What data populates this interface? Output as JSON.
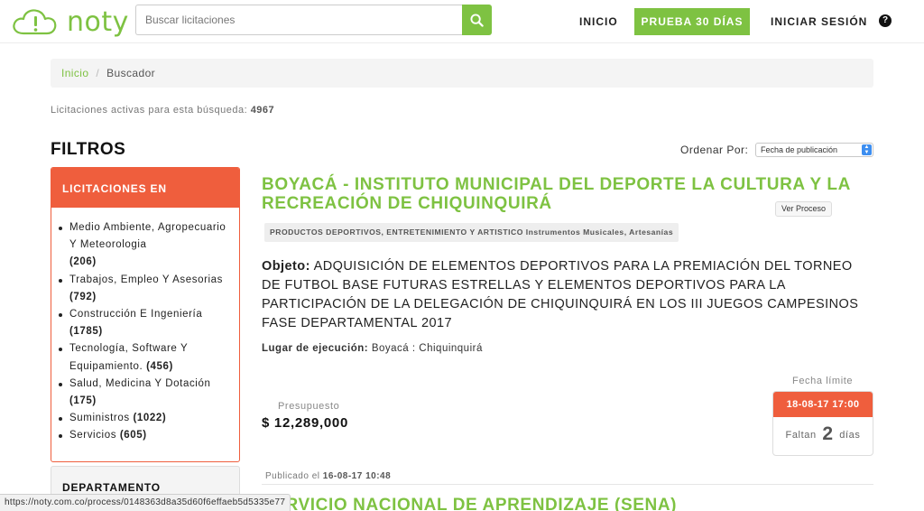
{
  "header": {
    "logo_text": "noty",
    "search_placeholder": "Buscar licitaciones",
    "nav": {
      "inicio": "INICIO",
      "trial": "PRUEBA 30 DÍAS",
      "login": "INICIAR SESIÓN",
      "help": "?"
    },
    "brand_color": "#7ec242"
  },
  "breadcrumb": {
    "home": "Inicio",
    "separator": "/",
    "current": "Buscador"
  },
  "summary": {
    "label": "Licitaciones activas para esta búsqueda:",
    "count": "4967"
  },
  "filters": {
    "title": "FILTROS",
    "panel_title": "LICITACIONES EN",
    "accent_color": "#ef5e3d",
    "items": [
      {
        "label": "Medio Ambiente, Agropecuario Y Meteorologia",
        "count": "(206)"
      },
      {
        "label": "Trabajos, Empleo Y Asesorias",
        "count": "(792)"
      },
      {
        "label": "Construcción E Ingeniería",
        "count": "(1785)"
      },
      {
        "label": "Tecnología, Software Y Equipamiento.",
        "count": "(456)"
      },
      {
        "label": "Salud, Medicina Y Dotación",
        "count": "(175)"
      },
      {
        "label": "Suministros",
        "count": "(1022)"
      },
      {
        "label": "Servicios",
        "count": "(605)"
      }
    ],
    "next_panel_title": "DEPARTAMENTO"
  },
  "order": {
    "label": "Ordenar Por:",
    "selected": "Fecha de publicación"
  },
  "result": {
    "title": "BOYACÁ - INSTITUTO MUNICIPAL DEL DEPORTE LA CULTURA Y LA RECREACIÓN DE CHIQUINQUIRÁ",
    "view_button": "Ver Proceso",
    "tag": "PRODUCTOS DEPORTIVOS, ENTRETENIMIENTO Y ARTISTICO Instrumentos Musicales, Artesanías",
    "objeto_label": "Objeto:",
    "objeto_text": "ADQUISICIÓN DE ELEMENTOS DEPORTIVOS PARA LA PREMIACIÓN DEL TORNEO DE FUTBOL BASE FUTURAS ESTRELLAS Y ELEMENTOS DEPORTIVOS PARA LA PARTICIPACIÓN DE LA DELEGACIÓN DE CHIQUINQUIRÁ EN LOS III JUEGOS CAMPESINOS FASE DEPARTAMENTAL 2017",
    "lugar_label": "Lugar de ejecución:",
    "lugar_value": "Boyacá : Chiquinquirá",
    "budget_label": "Presupuesto",
    "budget_value": "$ 12,289,000",
    "deadline_label": "Fecha límite",
    "deadline_date": "18-08-17 17:00",
    "remaining_prefix": "Faltan",
    "remaining_num": "2",
    "remaining_suffix": "días",
    "published_label": "Publicado el",
    "published_date": "16-08-17 10:48"
  },
  "next_result": {
    "title": "SERVICIO NACIONAL DE APRENDIZAJE (SENA)"
  },
  "statusbar": {
    "url": "https://noty.com.co/process/0148363d8a35d60f6effaeb5d5335e77"
  }
}
